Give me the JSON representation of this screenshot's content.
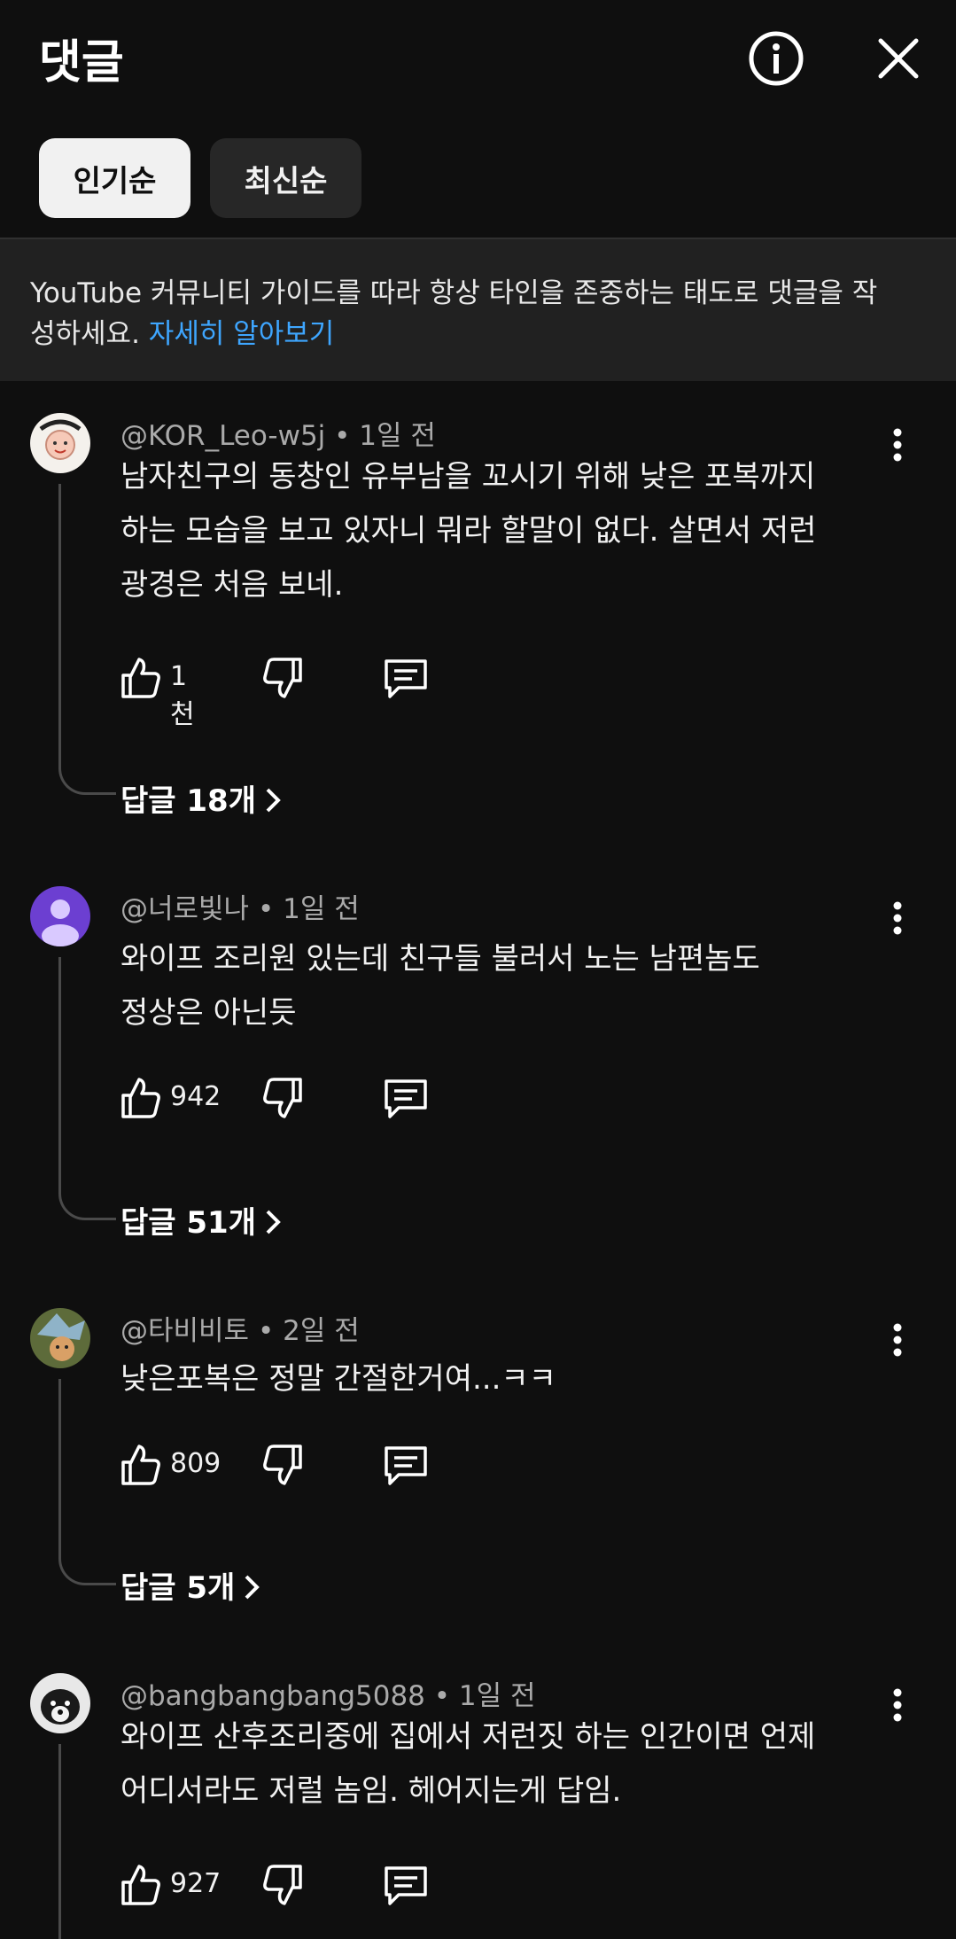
{
  "header": {
    "title": "댓글",
    "info_icon": "info-icon",
    "close_icon": "close-icon"
  },
  "tabs": [
    {
      "label": "인기순",
      "active": true
    },
    {
      "label": "최신순",
      "active": false
    }
  ],
  "guidelines": {
    "text": "YouTube 커뮤니티 가이드를 따라 항상 타인을 존중하는 태도로 댓글을 작성하세요.",
    "link": "자세히 알아보기"
  },
  "comments": [
    {
      "author": "@KOR_Leo-w5j",
      "time": "1일 전",
      "lines": [
        "남자친구의 동창인 유부남을 꼬시기 위해 낮은 포복까지",
        "하는 모습을 보고 있자니 뭐라 할말이 없다. 살면서 저런",
        "광경은 처음 보네."
      ],
      "likes": "1천",
      "replies": "답글 18개"
    },
    {
      "author": "@너로빛나",
      "time": "1일 전",
      "lines": [
        "와이프 조리원 있는데 친구들 불러서 노는 남편놈도",
        "정상은 아닌듯"
      ],
      "likes": "942",
      "replies": "답글 51개"
    },
    {
      "author": "@타비비토",
      "time": "2일 전",
      "lines": [
        "낮은포복은 정말 간절한거여...ㅋㅋ"
      ],
      "likes": "809",
      "replies": "답글 5개"
    },
    {
      "author": "@bangbangbang5088",
      "time": "1일 전",
      "lines": [
        "와이프 산후조리중에 집에서 저런짓 하는 인간이면 언제",
        "어디서라도 저럴 놈임. 헤어지는게 답임."
      ],
      "likes": "927"
    }
  ],
  "colors": {
    "background": "#0f0f0f",
    "link": "#3ea6ff",
    "meta": "#aaaaaa",
    "tab_active": "#f1f1f1",
    "tab_inactive": "#272727",
    "purple_avatar": "#6c3fd1"
  }
}
